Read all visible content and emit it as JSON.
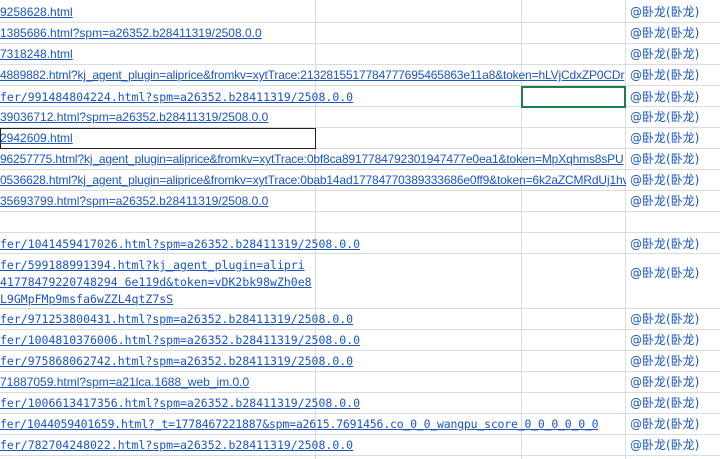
{
  "rows": [
    {
      "link": "9258628.html",
      "user": "@卧龙(卧龙)"
    },
    {
      "link": "1385686.html?spm=a26352.b28411319/2508.0.0",
      "user": "@卧龙(卧龙)"
    },
    {
      "link": "7318248.html",
      "user": "@卧龙(卧龙)"
    },
    {
      "link": "4889882.html?kj_agent_plugin=aliprice&fromkv=xytTrace:2132815517784777695465863e11a8&token=hLVjCdxZP0CDr",
      "user": "@卧龙(卧龙)"
    },
    {
      "link": "fer/991484804224.html?spm=a26352.b28411319/2508.0.0",
      "user": "@卧龙(卧龙)"
    },
    {
      "link": "39036712.html?spm=a26352.b28411319/2508.0.0",
      "user": "@卧龙(卧龙)"
    },
    {
      "link": "2942609.html",
      "user": "@卧龙(卧龙)"
    },
    {
      "link": "96257775.html?kj_agent_plugin=aliprice&fromkv=xytTrace:0bf8ca8917784792301947477e0ea1&token=MpXqhms8sPU",
      "user": "@卧龙(卧龙)"
    },
    {
      "link": "0536628.html?kj_agent_plugin=aliprice&fromkv=xytTrace:0bab14ad17784770389333686e0ff9&token=6k2aZCMRdUj1hv",
      "user": "@卧龙(卧龙)"
    },
    {
      "link": "35693799.html?spm=a26352.b28411319/2508.0.0",
      "user": "@卧龙(卧龙)"
    },
    {
      "link": "",
      "user": ""
    },
    {
      "link": "fer/1041459417026.html?spm=a26352.b28411319/2508.0.0",
      "user": "@卧龙(卧龙)"
    },
    {
      "link": "fer/599188991394.html?kj_agent_plugin=alipri",
      "line2": "41778479220748294 6e119d&token=vDK2bk98wZh0e8",
      "line3": "L9GMpFMp9msfa6wZZL4qtZ7sS",
      "user": "@卧龙(卧龙)"
    },
    {
      "link": "fer/971253800431.html?spm=a26352.b28411319/2508.0.0",
      "user": "@卧龙(卧龙)"
    },
    {
      "link": "fer/1004810376006.html?spm=a26352.b28411319/2508.0.0",
      "user": "@卧龙(卧龙)"
    },
    {
      "link": "fer/975868062742.html?spm=a26352.b28411319/2508.0.0",
      "user": "@卧龙(卧龙)"
    },
    {
      "link": "71887059.html?spm=a21lca.1688_web_im.0.0",
      "user": "@卧龙(卧龙)"
    },
    {
      "link": "fer/1006613417356.html?spm=a26352.b28411319/2508.0.0",
      "user": "@卧龙(卧龙)"
    },
    {
      "link": "fer/1044059401659.html?_t=1778467221887&spm=a2615.7691456.co_0_0_wangpu_score_0_0_0_0_0_0",
      "user": "@卧龙(卧龙)"
    },
    {
      "link": "fer/782704248022.html?spm=a26352.b28411319/2508.0.0",
      "user": "@卧龙(卧龙)"
    }
  ]
}
